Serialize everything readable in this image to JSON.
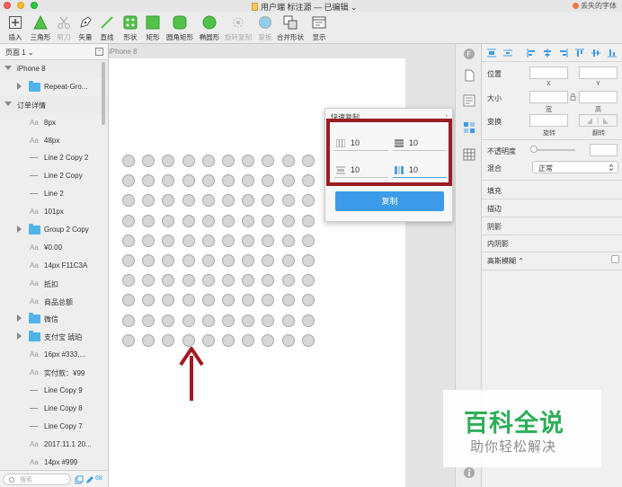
{
  "window": {
    "title": "用户端 标注源 — 已编辑 ⌄",
    "missing_fonts": "丢失的字体"
  },
  "toolbar": {
    "items": [
      {
        "label": "插入",
        "icon": "plus-icon"
      },
      {
        "label": "三角形",
        "icon": "triangle-icon"
      },
      {
        "label": "剪刀",
        "icon": "scissors-icon"
      },
      {
        "label": "矢量",
        "icon": "pen-icon"
      },
      {
        "label": "直线",
        "icon": "line-icon"
      },
      {
        "label": "形状",
        "icon": "shapes-icon"
      },
      {
        "label": "矩形",
        "icon": "rectangle-icon"
      },
      {
        "label": "圆角矩形",
        "icon": "rounded-rectangle-icon"
      },
      {
        "label": "椭圆形",
        "icon": "oval-icon"
      },
      {
        "label": "旋转复制",
        "icon": "rotate-copy-icon"
      },
      {
        "label": "蒙板",
        "icon": "mask-icon"
      },
      {
        "label": "合并形状",
        "icon": "combine-icon"
      },
      {
        "label": "显示",
        "icon": "view-icon"
      }
    ]
  },
  "layers": {
    "page_select": "页面 1 ⌄",
    "items": [
      {
        "label": "iPhone 8",
        "type": "artboard"
      },
      {
        "label": "Repeat-Gro...",
        "type": "folder"
      },
      {
        "label": "订单详情",
        "type": "artboard"
      },
      {
        "label": "8px",
        "type": "text"
      },
      {
        "label": "48px",
        "type": "text"
      },
      {
        "label": "Line 2 Copy 2",
        "type": "line"
      },
      {
        "label": "Line 2 Copy",
        "type": "line"
      },
      {
        "label": "Line 2",
        "type": "line"
      },
      {
        "label": "101px",
        "type": "text"
      },
      {
        "label": "Group 2 Copy",
        "type": "folder"
      },
      {
        "label": "¥0.00",
        "type": "text"
      },
      {
        "label": "14px F11C3A",
        "type": "text"
      },
      {
        "label": "抵扣",
        "type": "text"
      },
      {
        "label": "商品总额",
        "type": "text"
      },
      {
        "label": "微信",
        "type": "folder"
      },
      {
        "label": "支付宝 琥珀",
        "type": "folder"
      },
      {
        "label": "16px #333,...",
        "type": "text"
      },
      {
        "label": "实付款：¥99",
        "type": "text"
      },
      {
        "label": "Line Copy 9",
        "type": "line"
      },
      {
        "label": "Line Copy 8",
        "type": "line"
      },
      {
        "label": "Line Copy 7",
        "type": "line"
      },
      {
        "label": "2017.11.1 20...",
        "type": "text"
      },
      {
        "label": "14px #999",
        "type": "text"
      }
    ],
    "search_placeholder": "搜索",
    "count": "68"
  },
  "canvas": {
    "artboard_label": "iPhone 8",
    "grid_rows": 10,
    "grid_cols": 10
  },
  "popover": {
    "title": "快速复制",
    "close": "›",
    "col_count": "10",
    "row_count": "10",
    "h_spacing": "10",
    "v_spacing": "10",
    "copy_button": "复制"
  },
  "inspector": {
    "position_label": "位置",
    "x_label": "X",
    "y_label": "Y",
    "size_label": "大小",
    "width_label": "宽",
    "height_label": "高",
    "transform_label": "变换",
    "rotate_label": "旋转",
    "flip_label": "翻转",
    "opacity_label": "不透明度",
    "blend_label": "混合",
    "blend_value": "正常",
    "fill_label": "填充",
    "border_label": "描边",
    "shadow_label": "阴影",
    "inner_shadow_label": "内阴影",
    "blur_label": "高斯模糊 ⌃"
  },
  "watermark": {
    "title": "百科全说",
    "subtitle": "助你轻松解决"
  },
  "colors": {
    "accent": "#3c9be8",
    "highlight": "#9b1d24",
    "arrow": "#a31a22",
    "watermark_green": "#2fae58"
  }
}
